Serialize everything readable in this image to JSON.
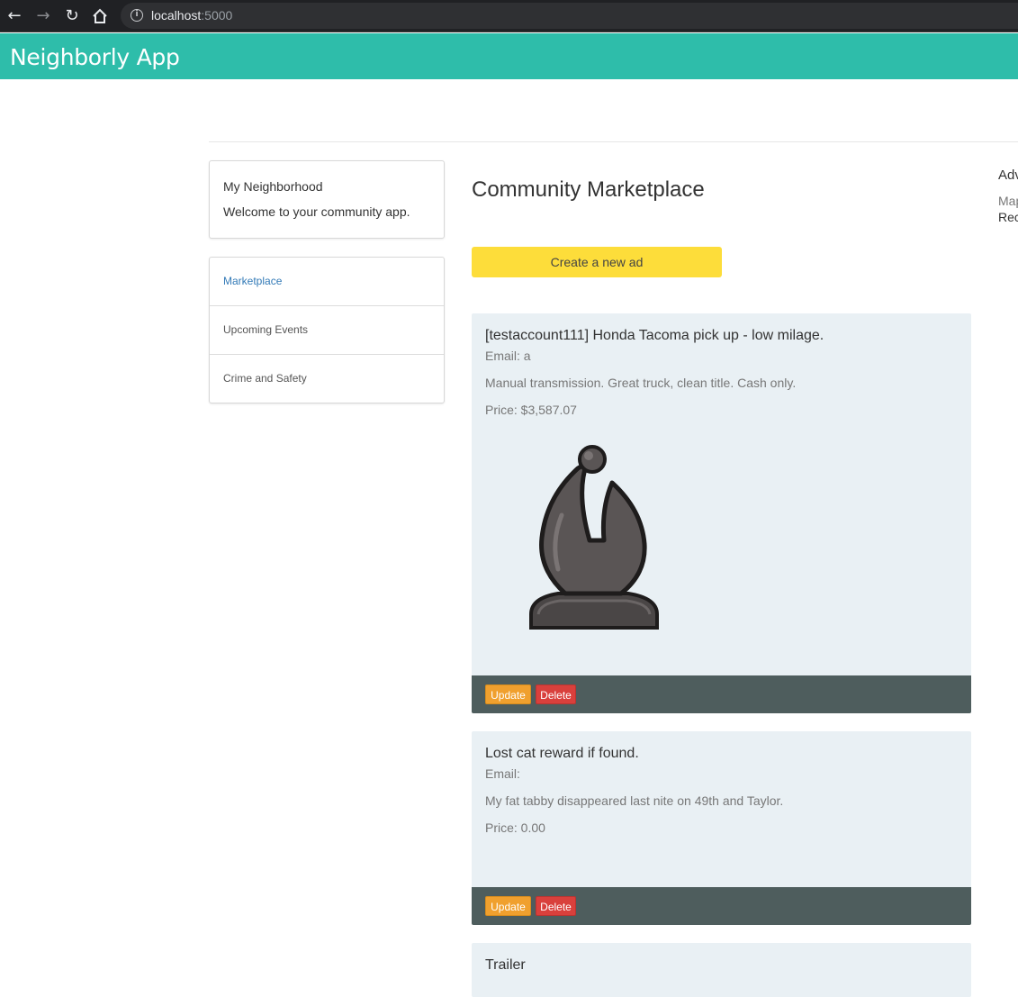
{
  "browser": {
    "url_host": "localhost",
    "url_port": ":5000",
    "icons": [
      "back-arrow-icon",
      "forward-arrow-icon",
      "reload-icon",
      "home-icon",
      "info-icon"
    ]
  },
  "app": {
    "brand": "Neighborly App",
    "accent": "#2ebdaa"
  },
  "neighborhood": {
    "title": "My Neighborhood",
    "welcome": "Welcome to your community app."
  },
  "menu": {
    "items": [
      {
        "label": "Marketplace"
      },
      {
        "label": "Upcoming Events"
      },
      {
        "label": "Crime and Safety"
      }
    ]
  },
  "main": {
    "title": "Community Marketplace",
    "create_label": "Create a new ad",
    "ads": [
      {
        "title": "[testaccount111] Honda Tacoma pick up - low milage.",
        "email": "Email: a",
        "description": "Manual transmission. Great truck, clean title. Cash only.",
        "price": "Price: $3,587.07",
        "image": "chess-bishop-icon",
        "update_label": "Update",
        "delete_label": "Delete"
      },
      {
        "title": "Lost cat reward if found.",
        "email": "Email:",
        "description": "My fat tabby disappeared last nite on 49th and Taylor.",
        "price": "Price: 0.00",
        "update_label": "Update",
        "delete_label": "Delete"
      },
      {
        "title": "Trailer"
      }
    ]
  },
  "right_sidebar": {
    "heading": "Adv",
    "map": "Map",
    "rec": "Rec"
  }
}
